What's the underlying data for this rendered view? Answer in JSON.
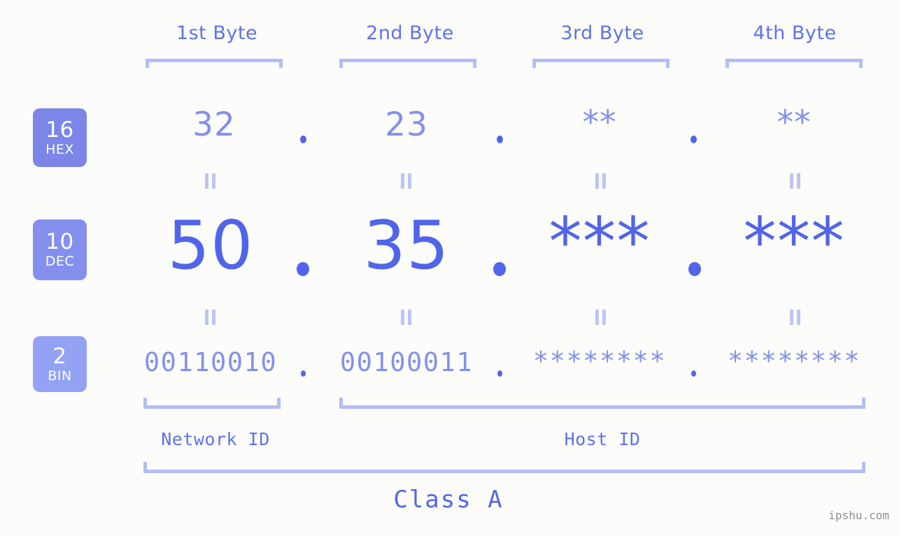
{
  "meta": {
    "watermark": "ipshu.com",
    "background_color": "#fcfdfa",
    "accent_color": "#5165ea",
    "accent_light_color": "#8490ee",
    "bracket_color": "#b3bdf7"
  },
  "header": {
    "byte_labels": [
      {
        "label": "1st Byte"
      },
      {
        "label": "2nd Byte"
      },
      {
        "label": "3rd Byte"
      },
      {
        "label": "4th Byte"
      }
    ]
  },
  "badges": [
    {
      "base": "16",
      "system": "HEX",
      "color": "#7b86e8"
    },
    {
      "base": "10",
      "system": "DEC",
      "color": "#8490ee"
    },
    {
      "base": "2",
      "system": "BIN",
      "color": "#93a2f5"
    }
  ],
  "rows": {
    "hex": {
      "name": "hex",
      "values": [
        "32",
        "23",
        "**",
        "**"
      ],
      "separator": "."
    },
    "dec": {
      "name": "dec",
      "values": [
        "50",
        "35",
        "***",
        "***"
      ],
      "separator": "."
    },
    "bin": {
      "name": "bin",
      "values": [
        "00110010",
        "00100011",
        "********",
        "********"
      ],
      "separator": "."
    }
  },
  "separators": {
    "equals_glyph": "="
  },
  "footer": {
    "network_id_label": "Network ID",
    "host_id_label": "Host ID",
    "class_label": "Class A"
  }
}
